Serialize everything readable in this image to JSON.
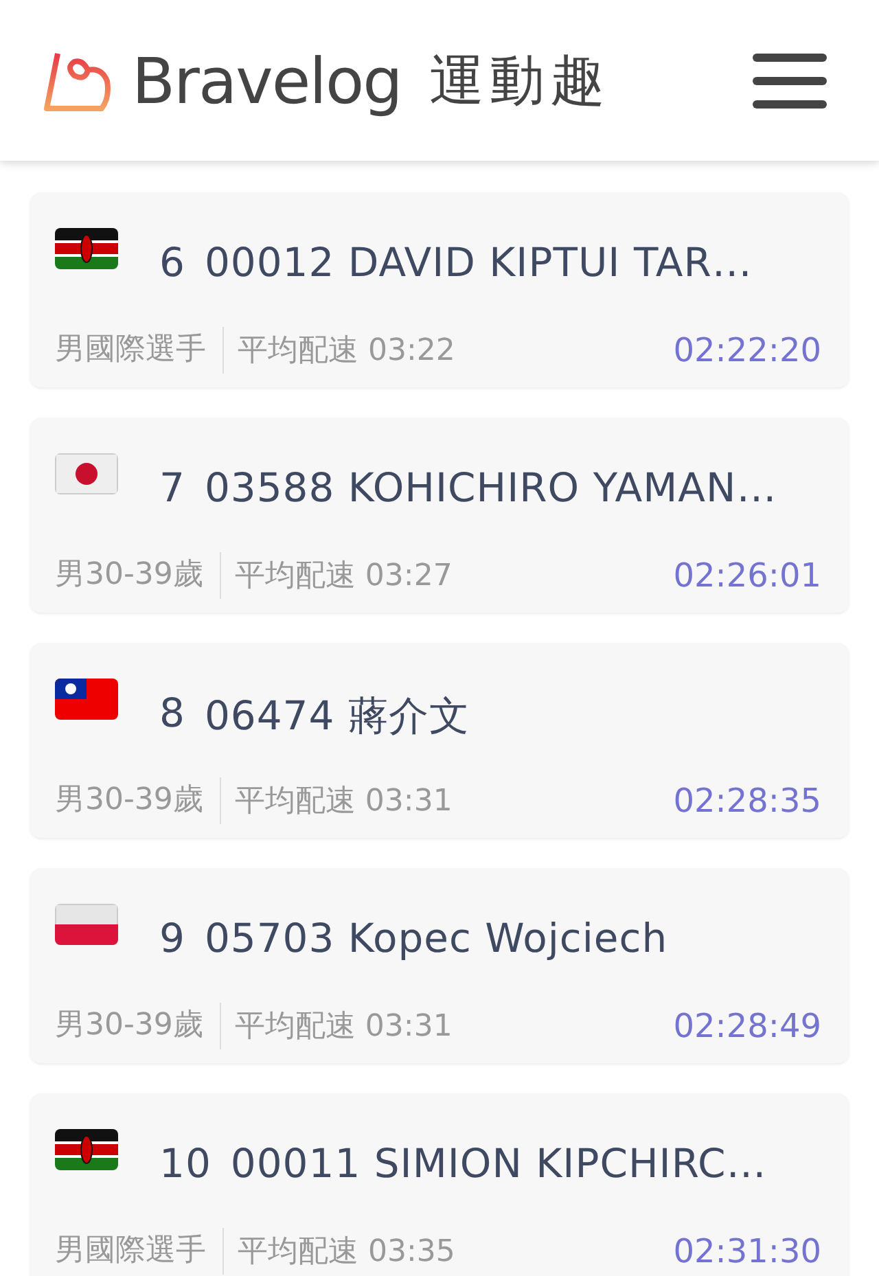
{
  "header": {
    "brand": "Bravelog",
    "brand_cn": "運動趣"
  },
  "results": [
    {
      "kind": "kenya",
      "rank": "6",
      "name": "00012 DAVID KIPTUI TAR…",
      "group": "男國際選手",
      "pace_label": "平均配速",
      "pace": "03:22",
      "time": "02:22:20"
    },
    {
      "kind": "japan",
      "rank": "7",
      "name": "03588 KOHICHIRO YAMAN…",
      "group": "男30-39歲",
      "pace_label": "平均配速",
      "pace": "03:27",
      "time": "02:26:01"
    },
    {
      "kind": "taiwan",
      "rank": "8",
      "name": "06474 蔣介文",
      "group": "男30-39歲",
      "pace_label": "平均配速",
      "pace": "03:31",
      "time": "02:28:35"
    },
    {
      "kind": "poland",
      "rank": "9",
      "name": "05703 Kopec Wojciech",
      "group": "男30-39歲",
      "pace_label": "平均配速",
      "pace": "03:31",
      "time": "02:28:49"
    },
    {
      "kind": "kenya",
      "rank": "10",
      "name": "00011 SIMION KIPCHIRC…",
      "group": "男國際選手",
      "pace_label": "平均配速",
      "pace": "03:35",
      "time": "02:31:30"
    }
  ]
}
